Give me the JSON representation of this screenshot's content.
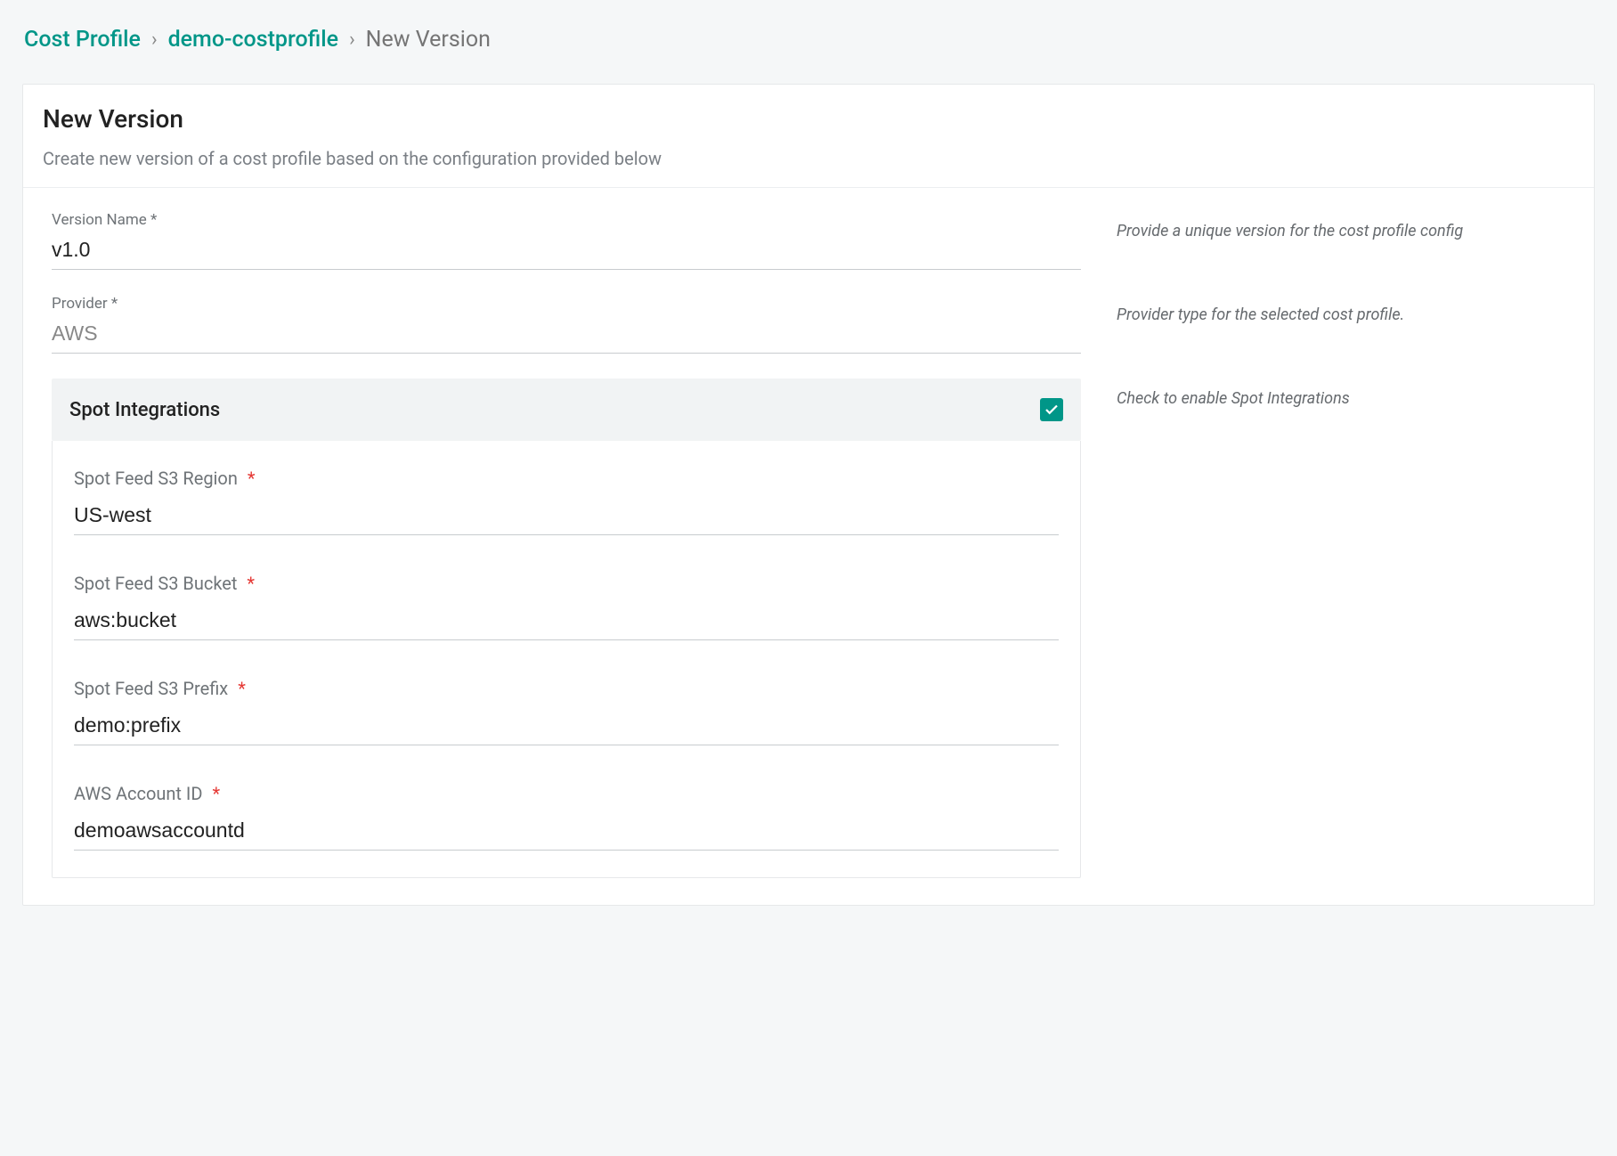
{
  "breadcrumb": {
    "root": "Cost Profile",
    "item": "demo-costprofile",
    "current": "New Version",
    "sep": "›"
  },
  "header": {
    "title": "New Version",
    "subtitle": "Create new version of a cost profile based on the configuration provided below"
  },
  "fields": {
    "version_name": {
      "label": "Version Name *",
      "value": "v1.0",
      "help": "Provide a unique version for the cost profile config"
    },
    "provider": {
      "label": "Provider *",
      "value": "AWS",
      "help": "Provider type for the selected cost profile."
    },
    "spot_toggle": {
      "label": "Spot Integrations",
      "help": "Check to enable Spot Integrations",
      "checked": true
    },
    "spot": {
      "region": {
        "label": "Spot Feed S3 Region",
        "value": "US-west"
      },
      "bucket": {
        "label": "Spot Feed S3 Bucket",
        "value": "aws:bucket"
      },
      "prefix": {
        "label": "Spot Feed S3 Prefix",
        "value": "demo:prefix"
      },
      "account": {
        "label": "AWS Account ID",
        "value": "demoawsaccountd"
      }
    }
  },
  "star": "*"
}
